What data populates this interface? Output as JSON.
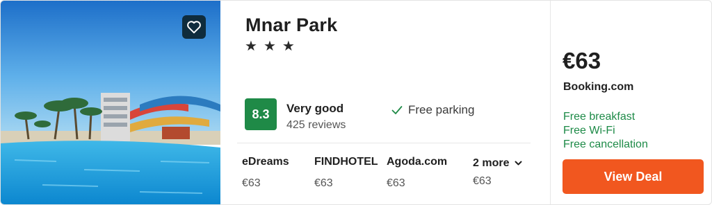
{
  "hotel": {
    "name": "Mnar Park",
    "stars": 3,
    "star_glyph": "★"
  },
  "rating": {
    "score": "8.3",
    "label": "Very good",
    "reviews": "425 reviews",
    "color": "#1f8a47"
  },
  "amenities": [
    {
      "icon": "check-icon",
      "label": "Free parking"
    }
  ],
  "providers": [
    {
      "name": "eDreams",
      "price": "€63"
    },
    {
      "name": "FINDHOTEL",
      "price": "€63"
    },
    {
      "name": "Agoda.com",
      "price": "€63"
    }
  ],
  "more": {
    "label": "2 more",
    "price": "€63",
    "icon": "chevron-down-icon"
  },
  "deal": {
    "price": "€63",
    "provider": "Booking.com",
    "perks": [
      "Free breakfast",
      "Free Wi-Fi",
      "Free cancellation"
    ],
    "button_label": "View Deal",
    "button_color": "#f1571f"
  },
  "favorite": {
    "icon": "heart-icon"
  }
}
